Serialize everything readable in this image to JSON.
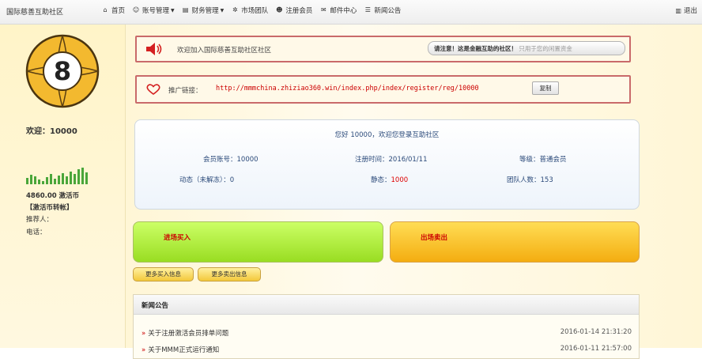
{
  "header": {
    "title": "国际慈善互助社区",
    "nav": [
      {
        "label": "首页",
        "icon": "home-icon",
        "dropdown": false
      },
      {
        "label": "账号管理",
        "icon": "user-icon",
        "dropdown": true
      },
      {
        "label": "财务管理",
        "icon": "wallet-icon",
        "dropdown": true
      },
      {
        "label": "市场团队",
        "icon": "team-icon",
        "dropdown": false
      },
      {
        "label": "注册会员",
        "icon": "add-user-icon",
        "dropdown": false
      },
      {
        "label": "邮件中心",
        "icon": "mail-icon",
        "dropdown": false
      },
      {
        "label": "新闻公告",
        "icon": "news-icon",
        "dropdown": false
      }
    ],
    "logout_label": "退出"
  },
  "sidebar": {
    "welcome": "欢迎：10000",
    "coins": "4860.00 激活币",
    "transfer": "【激活币转帐】",
    "referrer": "推荐人：",
    "phone": "电话："
  },
  "notice": {
    "message": "欢迎加入国际慈善互助社区社区",
    "tip_bold": "请注意！这是金融互助的社区！",
    "tip_sub": "只用于您的闲置资金"
  },
  "promo": {
    "label": "推广链接：",
    "url": "http://mmmchina.zhiziao360.win/index.php/index/register/reg/10000",
    "copy_label": "复制"
  },
  "account": {
    "greeting": "您好 10000，欢迎您登录互助社区",
    "member_id": "会员账号：10000",
    "register_time": "注册时间：2016/01/11",
    "level": "等级：普通会员",
    "dynamic": "动态（未解冻）：0",
    "static_label": "静态：",
    "static_value": "1000",
    "team": "团队人数：153"
  },
  "actions": {
    "buy_label": "进场买入",
    "sell_label": "出场卖出",
    "more_buy": "更多买入信息",
    "more_sell": "更多卖出信息"
  },
  "news": {
    "title": "新闻公告",
    "items": [
      {
        "title": "关于注册激活会员排单问题",
        "date": "2016-01-14 21:31:20"
      },
      {
        "title": "关于MMM正式运行通知",
        "date": "2016-01-11 21:57:00"
      }
    ]
  },
  "colors": {
    "buy_gradient": [
      "#ccff66",
      "#99dd22"
    ],
    "sell_gradient": [
      "#ffdd55",
      "#f4ad10"
    ],
    "alert_red": "#cc0000"
  }
}
